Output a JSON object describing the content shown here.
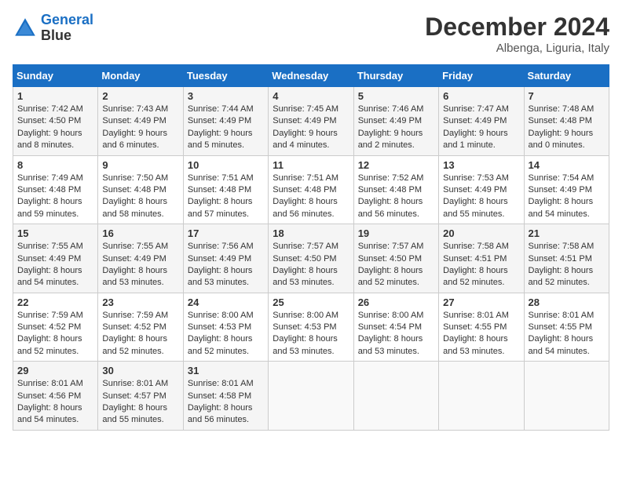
{
  "header": {
    "logo_line1": "General",
    "logo_line2": "Blue",
    "month": "December 2024",
    "location": "Albenga, Liguria, Italy"
  },
  "weekdays": [
    "Sunday",
    "Monday",
    "Tuesday",
    "Wednesday",
    "Thursday",
    "Friday",
    "Saturday"
  ],
  "weeks": [
    [
      {
        "day": "1",
        "sunrise": "7:42 AM",
        "sunset": "4:50 PM",
        "daylight": "9 hours and 8 minutes."
      },
      {
        "day": "2",
        "sunrise": "7:43 AM",
        "sunset": "4:49 PM",
        "daylight": "9 hours and 6 minutes."
      },
      {
        "day": "3",
        "sunrise": "7:44 AM",
        "sunset": "4:49 PM",
        "daylight": "9 hours and 5 minutes."
      },
      {
        "day": "4",
        "sunrise": "7:45 AM",
        "sunset": "4:49 PM",
        "daylight": "9 hours and 4 minutes."
      },
      {
        "day": "5",
        "sunrise": "7:46 AM",
        "sunset": "4:49 PM",
        "daylight": "9 hours and 2 minutes."
      },
      {
        "day": "6",
        "sunrise": "7:47 AM",
        "sunset": "4:49 PM",
        "daylight": "9 hours and 1 minute."
      },
      {
        "day": "7",
        "sunrise": "7:48 AM",
        "sunset": "4:48 PM",
        "daylight": "9 hours and 0 minutes."
      }
    ],
    [
      {
        "day": "8",
        "sunrise": "7:49 AM",
        "sunset": "4:48 PM",
        "daylight": "8 hours and 59 minutes."
      },
      {
        "day": "9",
        "sunrise": "7:50 AM",
        "sunset": "4:48 PM",
        "daylight": "8 hours and 58 minutes."
      },
      {
        "day": "10",
        "sunrise": "7:51 AM",
        "sunset": "4:48 PM",
        "daylight": "8 hours and 57 minutes."
      },
      {
        "day": "11",
        "sunrise": "7:51 AM",
        "sunset": "4:48 PM",
        "daylight": "8 hours and 56 minutes."
      },
      {
        "day": "12",
        "sunrise": "7:52 AM",
        "sunset": "4:48 PM",
        "daylight": "8 hours and 56 minutes."
      },
      {
        "day": "13",
        "sunrise": "7:53 AM",
        "sunset": "4:49 PM",
        "daylight": "8 hours and 55 minutes."
      },
      {
        "day": "14",
        "sunrise": "7:54 AM",
        "sunset": "4:49 PM",
        "daylight": "8 hours and 54 minutes."
      }
    ],
    [
      {
        "day": "15",
        "sunrise": "7:55 AM",
        "sunset": "4:49 PM",
        "daylight": "8 hours and 54 minutes."
      },
      {
        "day": "16",
        "sunrise": "7:55 AM",
        "sunset": "4:49 PM",
        "daylight": "8 hours and 53 minutes."
      },
      {
        "day": "17",
        "sunrise": "7:56 AM",
        "sunset": "4:49 PM",
        "daylight": "8 hours and 53 minutes."
      },
      {
        "day": "18",
        "sunrise": "7:57 AM",
        "sunset": "4:50 PM",
        "daylight": "8 hours and 53 minutes."
      },
      {
        "day": "19",
        "sunrise": "7:57 AM",
        "sunset": "4:50 PM",
        "daylight": "8 hours and 52 minutes."
      },
      {
        "day": "20",
        "sunrise": "7:58 AM",
        "sunset": "4:51 PM",
        "daylight": "8 hours and 52 minutes."
      },
      {
        "day": "21",
        "sunrise": "7:58 AM",
        "sunset": "4:51 PM",
        "daylight": "8 hours and 52 minutes."
      }
    ],
    [
      {
        "day": "22",
        "sunrise": "7:59 AM",
        "sunset": "4:52 PM",
        "daylight": "8 hours and 52 minutes."
      },
      {
        "day": "23",
        "sunrise": "7:59 AM",
        "sunset": "4:52 PM",
        "daylight": "8 hours and 52 minutes."
      },
      {
        "day": "24",
        "sunrise": "8:00 AM",
        "sunset": "4:53 PM",
        "daylight": "8 hours and 52 minutes."
      },
      {
        "day": "25",
        "sunrise": "8:00 AM",
        "sunset": "4:53 PM",
        "daylight": "8 hours and 53 minutes."
      },
      {
        "day": "26",
        "sunrise": "8:00 AM",
        "sunset": "4:54 PM",
        "daylight": "8 hours and 53 minutes."
      },
      {
        "day": "27",
        "sunrise": "8:01 AM",
        "sunset": "4:55 PM",
        "daylight": "8 hours and 53 minutes."
      },
      {
        "day": "28",
        "sunrise": "8:01 AM",
        "sunset": "4:55 PM",
        "daylight": "8 hours and 54 minutes."
      }
    ],
    [
      {
        "day": "29",
        "sunrise": "8:01 AM",
        "sunset": "4:56 PM",
        "daylight": "8 hours and 54 minutes."
      },
      {
        "day": "30",
        "sunrise": "8:01 AM",
        "sunset": "4:57 PM",
        "daylight": "8 hours and 55 minutes."
      },
      {
        "day": "31",
        "sunrise": "8:01 AM",
        "sunset": "4:58 PM",
        "daylight": "8 hours and 56 minutes."
      },
      null,
      null,
      null,
      null
    ]
  ]
}
